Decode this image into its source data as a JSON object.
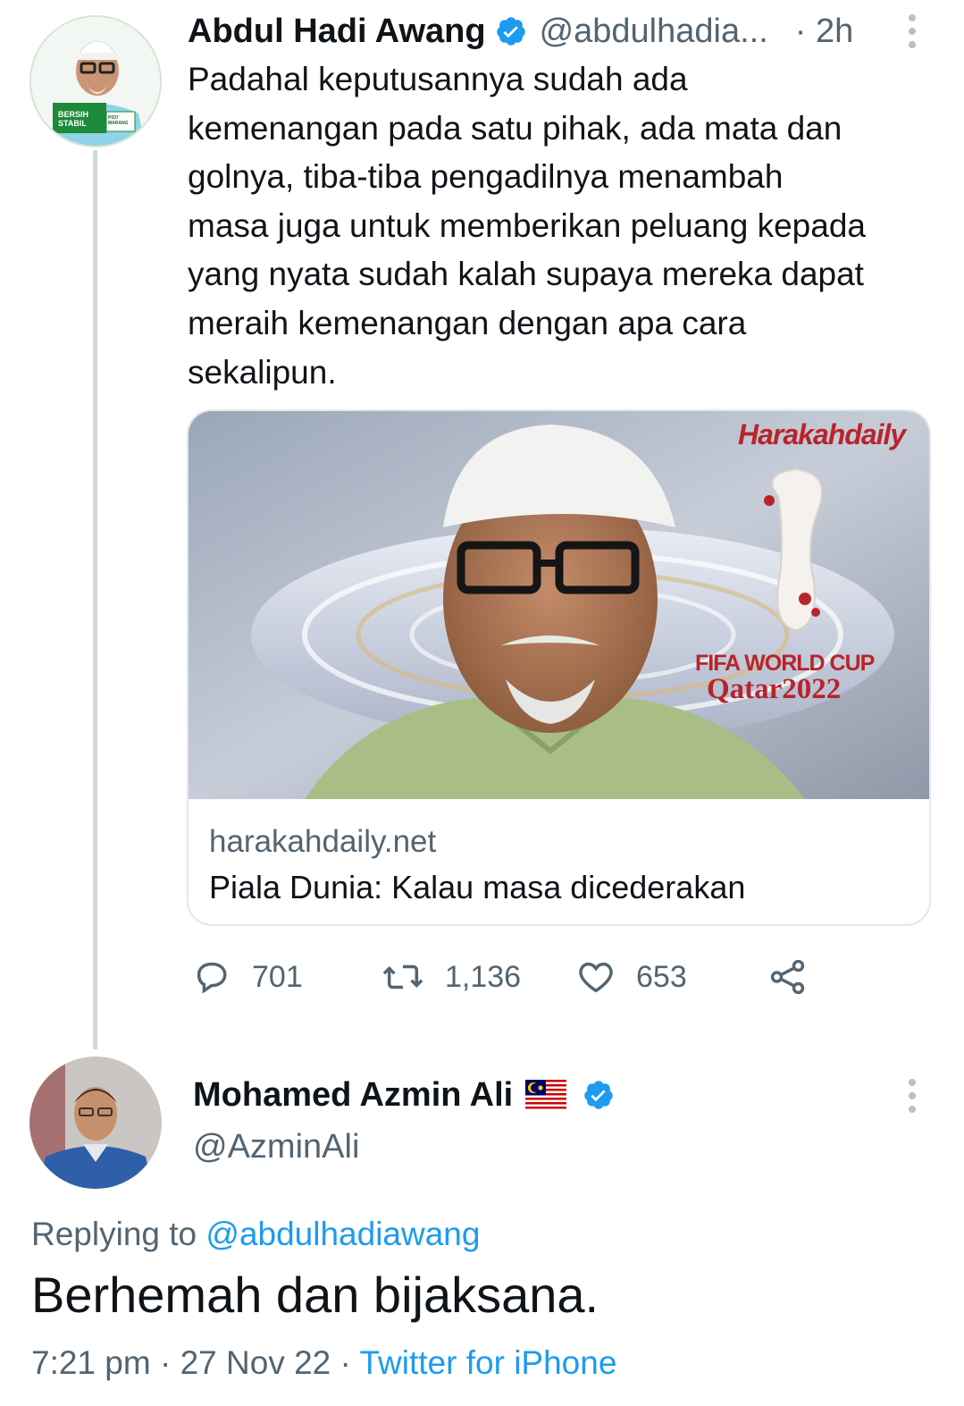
{
  "tweet": {
    "author_name": "Abdul Hadi Awang",
    "handle": "@abdulhadia...",
    "time": "· 2h",
    "text_lines": [
      "Padahal keputusannya sudah ada",
      "kemenangan pada satu pihak, ada mata dan",
      "golnya, tiba-tiba pengadilnya menambah",
      "masa juga untuk memberikan peluang kepada",
      "yang nyata sudah kalah supaya mereka dapat",
      "meraih kemenangan dengan apa cara",
      "sekalipun."
    ],
    "avatar_badge": {
      "line1": "BERSIH",
      "line2": "STABIL",
      "tag": "P037 MARANG"
    },
    "card": {
      "domain": "harakahdaily.net",
      "title": "Piala Dunia: Kalau masa dicederakan",
      "image_brand": "Harakahdaily",
      "image_caption_line1": "FIFA WORLD CUP",
      "image_caption_line2": "Qatar2022"
    },
    "actions": {
      "replies": "701",
      "retweets": "1,136",
      "likes": "653"
    }
  },
  "reply": {
    "author_name": "Mohamed Azmin Ali",
    "handle": "@AzminAli",
    "replying_to_prefix": "Replying to",
    "replying_to_handle": "@abdulhadiawang",
    "text": "Berhemah dan bijaksana.",
    "time": "7:21 pm",
    "date": "27 Nov 22",
    "source": "Twitter for iPhone",
    "separator": "·"
  },
  "colors": {
    "accent": "#1d9bf0",
    "text": "#0f1419",
    "muted": "#536471",
    "border": "#e1e8ed",
    "brand_red": "#b8242a"
  }
}
